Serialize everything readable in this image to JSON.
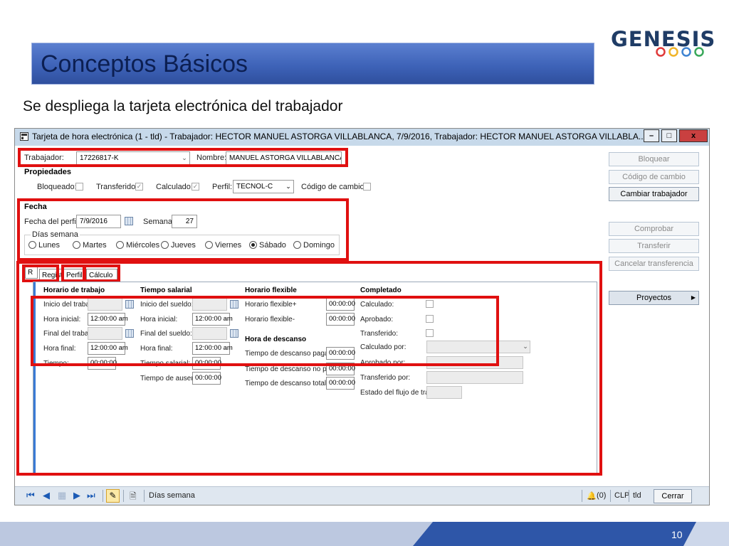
{
  "slide": {
    "title": "Conceptos Básicos",
    "subtitle": "Se despliega la tarjeta electrónica del trabajador",
    "logo_text": "GENESIS",
    "logo_ring_colors": [
      "#e03a3a",
      "#f0b429",
      "#3f84d2",
      "#39a85a"
    ],
    "page_number": "10"
  },
  "window": {
    "title": "Tarjeta de hora electrónica (1 - tld) - Trabajador: HECTOR MANUEL ASTORGA  VILLABLANCA, 7/9/2016, Trabajador: HECTOR MANUEL ASTORGA  VILLABLA...",
    "minimize_label": "–",
    "maximize_label": "□",
    "close_label": "x"
  },
  "worker": {
    "label": "Trabajador:",
    "value": "17226817-K",
    "name_label": "Nombre:",
    "name_value": "MANUEL ASTORGA  VILLABLANCA"
  },
  "properties": {
    "title": "Propiedades",
    "bloqueado": "Bloqueado:",
    "transferido": "Transferido:",
    "calculado": "Calculado:",
    "perfil_label": "Perfil:",
    "perfil_value": "TECNOL-C",
    "codigo_cambio": "Código de cambio:"
  },
  "fecha": {
    "title": "Fecha",
    "fecha_perfil_label": "Fecha del perfil:",
    "fecha_perfil_value": "7/9/2016",
    "semana_label": "Semana:",
    "semana_value": "27",
    "dias_semana_label": "Días semana",
    "days": [
      "Lunes",
      "Martes",
      "Miércoles",
      "Jueves",
      "Viernes",
      "Sábado",
      "Domingo"
    ],
    "selected_day": "Sábado"
  },
  "tabs": {
    "r_label": "R",
    "registro": "Registro",
    "perfil": "Perfil",
    "calculo": "Cálculo"
  },
  "horario": {
    "title": "Horario de trabajo",
    "inicio_trabajo": "Inicio del trabajo:",
    "hora_inicial": "Hora inicial:",
    "hora_inicial_value": "12:00:00 am",
    "final_trabajo": "Final del trabajo:",
    "hora_final": "Hora final:",
    "hora_final_value": "12:00:00 am",
    "tiempo": "Tiempo:",
    "tiempo_value": "00:00:00"
  },
  "salarial": {
    "title": "Tiempo salarial",
    "inicio_sueldo": "Inicio del sueldo:",
    "hora_inicial": "Hora inicial:",
    "hora_inicial_value": "12:00:00 am",
    "final_sueldo": "Final del sueldo:",
    "hora_final": "Hora final:",
    "hora_final_value": "12:00:00 am",
    "tiempo_salarial": "Tiempo salarial:",
    "tiempo_salarial_value": "00:00:00",
    "tiempo_ausencia": "Tiempo de ausencia:",
    "tiempo_ausencia_value": "00:00:00"
  },
  "flexible": {
    "title": "Horario flexible",
    "flex_plus": "Horario flexible+",
    "flex_plus_value": "00:00:00",
    "flex_minus": "Horario flexible-",
    "flex_minus_value": "00:00:00",
    "descanso_title": "Hora de descanso",
    "descanso_pagado": "Tiempo de descanso pagado:",
    "descanso_pagado_value": "00:00:00",
    "descanso_no_pagado": "Tiempo de descanso no pagado:",
    "descanso_no_pagado_value": "00:00:00",
    "descanso_total": "Tiempo de descanso total:",
    "descanso_total_value": "00:00:00"
  },
  "completado": {
    "title": "Completado",
    "calculado": "Calculado:",
    "aprobado": "Aprobado:",
    "transferido": "Transferido:",
    "calculado_por": "Calculado por:",
    "aprobado_por": "Aprobado por:",
    "transferido_por": "Transferido por:",
    "estado_flujo": "Estado del flujo de trabajo:"
  },
  "actions": {
    "bloquear": "Bloquear",
    "codigo_cambio": "Código de cambio",
    "cambiar_trabajador": "Cambiar trabajador",
    "comprobar": "Comprobar",
    "transferir": "Transferir",
    "cancelar_transferencia": "Cancelar transferencia",
    "proyectos": "Proyectos"
  },
  "statusbar": {
    "dias_semana": "Días semana",
    "alerts": "(0)",
    "currency": "CLP",
    "company": "tld",
    "cerrar": "Cerrar"
  }
}
